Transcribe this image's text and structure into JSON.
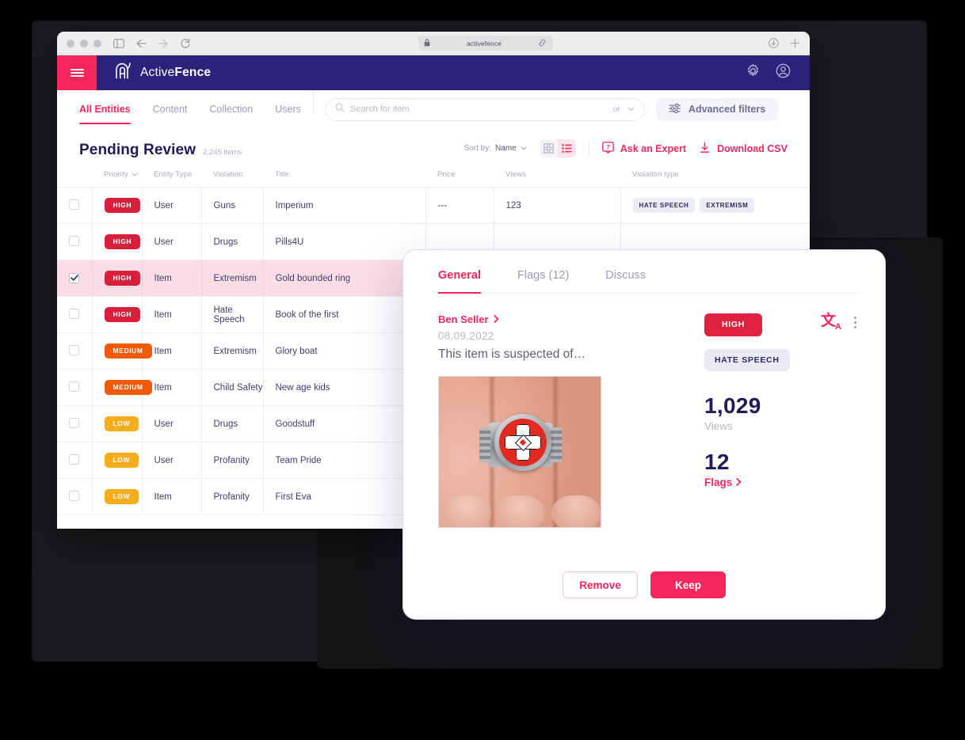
{
  "browser": {
    "url": "activefence",
    "icons": [
      "lock-icon",
      "link-icon",
      "sidebar-icon",
      "back-arrow-icon",
      "forward-arrow-icon",
      "reload-icon",
      "download-icon",
      "new-tab-icon"
    ]
  },
  "app": {
    "brand_prefix": "Active",
    "brand_suffix": "Fence",
    "menu_label": "menu",
    "header_icons": [
      "gear-icon",
      "account-icon"
    ]
  },
  "nav": {
    "tabs": [
      {
        "label": "All Entities",
        "active": true
      },
      {
        "label": "Content",
        "active": false
      },
      {
        "label": "Collection",
        "active": false
      },
      {
        "label": "Users",
        "active": false
      }
    ],
    "search_placeholder": "Search for item",
    "search_value": "",
    "operator_label": "or",
    "advanced_filters_label": "Advanced filters"
  },
  "page": {
    "title": "Pending Review",
    "count_label": "2,245 items",
    "sort_prefix": "Sort by:",
    "sort_value": "Name",
    "ask_expert_label": "Ask an Expert",
    "download_label": "Download CSV",
    "view_mode": "list"
  },
  "table": {
    "columns": [
      "Priority",
      "Entity Type",
      "Violation",
      "Title",
      "Price",
      "Views",
      "Violation type"
    ],
    "rows": [
      {
        "priority": "HIGH",
        "level": "high",
        "entity": "User",
        "violation": "Guns",
        "title": "Imperium",
        "price": "---",
        "views": "123",
        "tags": [
          "HATE SPEECH",
          "EXTREMISM"
        ],
        "selected": false
      },
      {
        "priority": "HIGH",
        "level": "high",
        "entity": "User",
        "violation": "Drugs",
        "title": "Pills4U",
        "price": "",
        "views": "",
        "tags": [],
        "selected": false
      },
      {
        "priority": "HIGH",
        "level": "high",
        "entity": "Item",
        "violation": "Extremism",
        "title": "Gold bounded ring",
        "price": "",
        "views": "",
        "tags": [],
        "selected": true
      },
      {
        "priority": "HIGH",
        "level": "high",
        "entity": "Item",
        "violation": "Hate Speech",
        "title": "Book of the first",
        "price": "",
        "views": "",
        "tags": [],
        "selected": false
      },
      {
        "priority": "MEDIUM",
        "level": "medium",
        "entity": "Item",
        "violation": "Extremism",
        "title": "Glory boat",
        "price": "",
        "views": "",
        "tags": [],
        "selected": false
      },
      {
        "priority": "MEDIUM",
        "level": "medium",
        "entity": "Item",
        "violation": "Child Safety",
        "title": "New age kids",
        "price": "",
        "views": "",
        "tags": [],
        "selected": false
      },
      {
        "priority": "LOW",
        "level": "low",
        "entity": "User",
        "violation": "Drugs",
        "title": "Goodstuff",
        "price": "",
        "views": "",
        "tags": [],
        "selected": false
      },
      {
        "priority": "LOW",
        "level": "low",
        "entity": "User",
        "violation": "Profanity",
        "title": "Team Pride",
        "price": "",
        "views": "",
        "tags": [],
        "selected": false
      },
      {
        "priority": "LOW",
        "level": "low",
        "entity": "Item",
        "violation": "Profanity",
        "title": "First Eva",
        "price": "",
        "views": "",
        "tags": [],
        "selected": false
      }
    ]
  },
  "modal": {
    "tabs": [
      {
        "label": "General",
        "active": true
      },
      {
        "label": "Flags (12)",
        "active": false
      },
      {
        "label": "Discuss",
        "active": false
      }
    ],
    "seller_name": "Ben Seller",
    "date": "08.09.2022",
    "description": "This item is suspected of…",
    "image_alt": "gold-bounded-ring-photo",
    "priority_badge": "HIGH",
    "violation_badge": "HATE SPEECH",
    "views_value": "1,029",
    "views_label": "Views",
    "flags_value": "12",
    "flags_label": "Flags",
    "translate_icon": "文",
    "translate_icon_sub": "A",
    "remove_label": "Remove",
    "keep_label": "Keep"
  },
  "colors": {
    "brand_navy": "#2b2379",
    "accent_pink": "#f5265c",
    "high": "#d8203c",
    "medium": "#f05a09",
    "low": "#f5ad1e"
  }
}
